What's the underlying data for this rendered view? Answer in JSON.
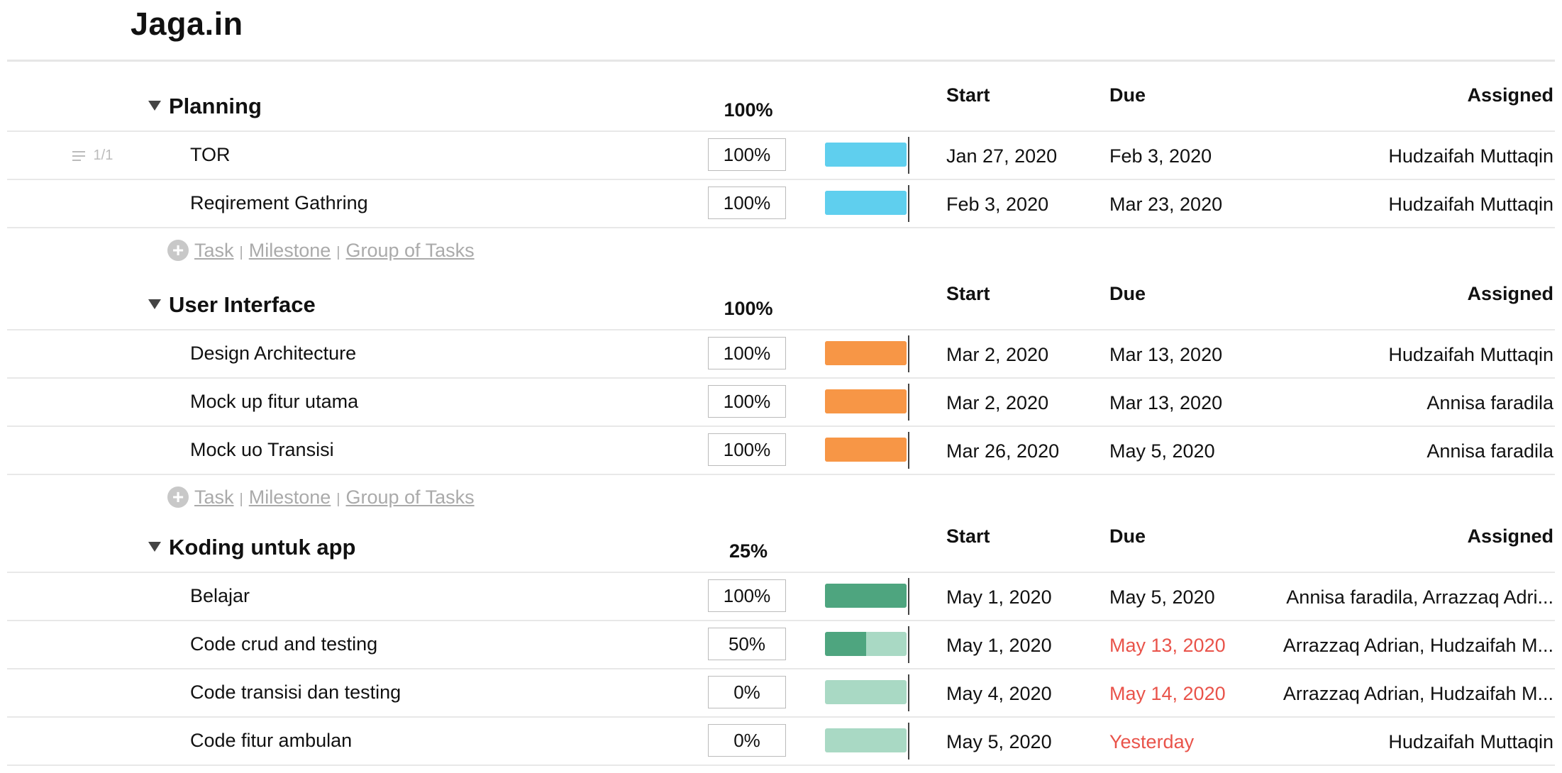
{
  "app_title": "Jaga.in",
  "columns": {
    "start": "Start",
    "due": "Due",
    "assigned": "Assigned"
  },
  "add_links": {
    "task": "Task",
    "milestone": "Milestone",
    "group": "Group of Tasks",
    "separator": "|"
  },
  "colors": {
    "blue": "#5fcfee",
    "orange": "#f79646",
    "green_dark": "#4ea57f",
    "green_light": "#a9d9c4",
    "overdue": "#e9534a"
  },
  "groups": [
    {
      "name": "Planning",
      "pct": "100%",
      "tasks": [
        {
          "name": "TOR",
          "pct": "100%",
          "progress": 1.0,
          "start": "Jan 27, 2020",
          "due": "Feb 3, 2020",
          "assigned": "Hudzaifah Muttaqin",
          "overdue": false,
          "color": "blue",
          "subtasks": "1/1"
        },
        {
          "name": "Reqirement Gathring",
          "pct": "100%",
          "progress": 1.0,
          "start": "Feb 3, 2020",
          "due": "Mar 23, 2020",
          "assigned": "Hudzaifah Muttaqin",
          "overdue": false,
          "color": "blue"
        }
      ]
    },
    {
      "name": "User Interface",
      "pct": "100%",
      "tasks": [
        {
          "name": "Design Architecture",
          "pct": "100%",
          "progress": 1.0,
          "start": "Mar 2, 2020",
          "due": "Mar 13, 2020",
          "assigned": "Hudzaifah Muttaqin",
          "overdue": false,
          "color": "orange"
        },
        {
          "name": "Mock up fitur utama",
          "pct": "100%",
          "progress": 1.0,
          "start": "Mar 2, 2020",
          "due": "Mar 13, 2020",
          "assigned": "Annisa faradila",
          "overdue": false,
          "color": "orange"
        },
        {
          "name": "Mock uo Transisi",
          "pct": "100%",
          "progress": 1.0,
          "start": "Mar 26, 2020",
          "due": "May 5, 2020",
          "assigned": "Annisa faradila",
          "overdue": false,
          "color": "orange"
        }
      ]
    },
    {
      "name": "Koding untuk app",
      "pct": "25%",
      "tasks": [
        {
          "name": "Belajar",
          "pct": "100%",
          "progress": 1.0,
          "start": "May 1, 2020",
          "due": "May 5, 2020",
          "assigned": "Annisa faradila, Arrazzaq Adri...",
          "overdue": false,
          "color": "green"
        },
        {
          "name": "Code crud and testing",
          "pct": "50%",
          "progress": 0.5,
          "start": "May 1, 2020",
          "due": "May 13, 2020",
          "assigned": "Arrazzaq Adrian, Hudzaifah M...",
          "overdue": true,
          "color": "green"
        },
        {
          "name": "Code transisi dan testing",
          "pct": "0%",
          "progress": 0.0,
          "start": "May 4, 2020",
          "due": "May 14, 2020",
          "assigned": "Arrazzaq Adrian, Hudzaifah M...",
          "overdue": true,
          "color": "green"
        },
        {
          "name": "Code fitur ambulan",
          "pct": "0%",
          "progress": 0.0,
          "start": "May 5, 2020",
          "due": "Yesterday",
          "assigned": "Hudzaifah Muttaqin",
          "overdue": true,
          "color": "green"
        }
      ]
    }
  ]
}
